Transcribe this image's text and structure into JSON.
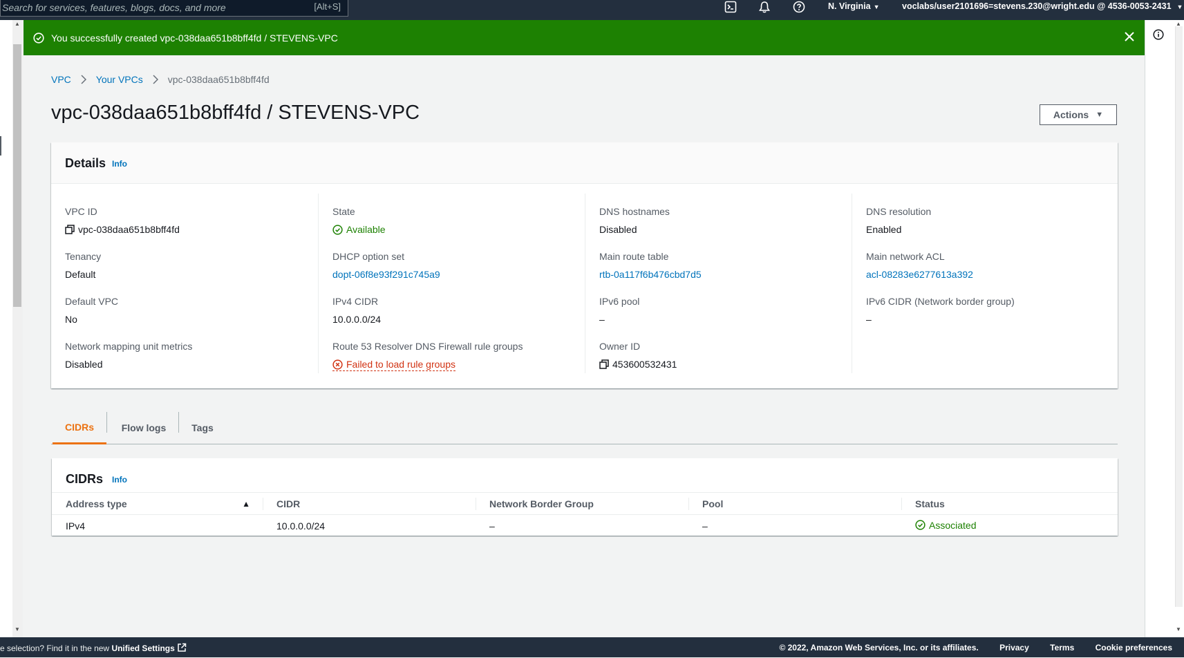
{
  "topbar": {
    "search_placeholder": "Search for services, features, blogs, docs, and more",
    "search_shortcut": "[Alt+S]",
    "region": "N. Virginia",
    "account": "voclabs/user2101696=stevens.230@wright.edu @ 4536-0053-2431",
    "icons": [
      "cloudshell-icon",
      "bell-icon",
      "help-icon"
    ]
  },
  "flash": {
    "message": "You successfully created vpc-038daa651b8bff4fd / STEVENS-VPC",
    "color": "#1d8102"
  },
  "breadcrumb": {
    "items": [
      "VPC",
      "Your VPCs",
      "vpc-038daa651b8bff4fd"
    ]
  },
  "page": {
    "title": "vpc-038daa651b8bff4fd / STEVENS-VPC",
    "actions_label": "Actions"
  },
  "details": {
    "title": "Details",
    "info_label": "Info",
    "columns": [
      [
        {
          "label": "VPC ID",
          "value": "vpc-038daa651b8bff4fd"
        },
        {
          "label": "Tenancy",
          "value": "Default"
        },
        {
          "label": "Default VPC",
          "value": "No"
        },
        {
          "label": "Network mapping unit metrics",
          "value": "Disabled"
        }
      ],
      [
        {
          "label": "State",
          "value": "Available"
        },
        {
          "label": "DHCP option set",
          "value": "dopt-06f8e93f291c745a9"
        },
        {
          "label": "IPv4 CIDR",
          "value": "10.0.0.0/24"
        },
        {
          "label": "Route 53 Resolver DNS Firewall rule groups",
          "value": "Failed to load rule groups"
        }
      ],
      [
        {
          "label": "DNS hostnames",
          "value": "Disabled"
        },
        {
          "label": "Main route table",
          "value": "rtb-0a117f6b476cbd7d5"
        },
        {
          "label": "IPv6 pool",
          "value": "–"
        },
        {
          "label": "Owner ID",
          "value": "453600532431"
        }
      ],
      [
        {
          "label": "DNS resolution",
          "value": "Enabled"
        },
        {
          "label": "Main network ACL",
          "value": "acl-08283e6277613a392"
        },
        {
          "label": "IPv6 CIDR (Network border group)",
          "value": "–"
        }
      ]
    ]
  },
  "tabs": [
    {
      "label": "CIDRs",
      "active": true
    },
    {
      "label": "Flow logs",
      "active": false
    },
    {
      "label": "Tags",
      "active": false
    }
  ],
  "cidrs": {
    "title": "CIDRs",
    "info_label": "Info",
    "columns": [
      "Address type",
      "CIDR",
      "Network Border Group",
      "Pool",
      "Status"
    ],
    "rows": [
      [
        "IPv4",
        "10.0.0.0/24",
        "–",
        "–",
        "Associated"
      ]
    ]
  },
  "footer": {
    "left_text": "e selection? Find it in the new",
    "left_link": "Unified Settings",
    "copyright": "© 2022, Amazon Web Services, Inc. or its affiliates.",
    "links": [
      "Privacy",
      "Terms",
      "Cookie preferences"
    ]
  }
}
